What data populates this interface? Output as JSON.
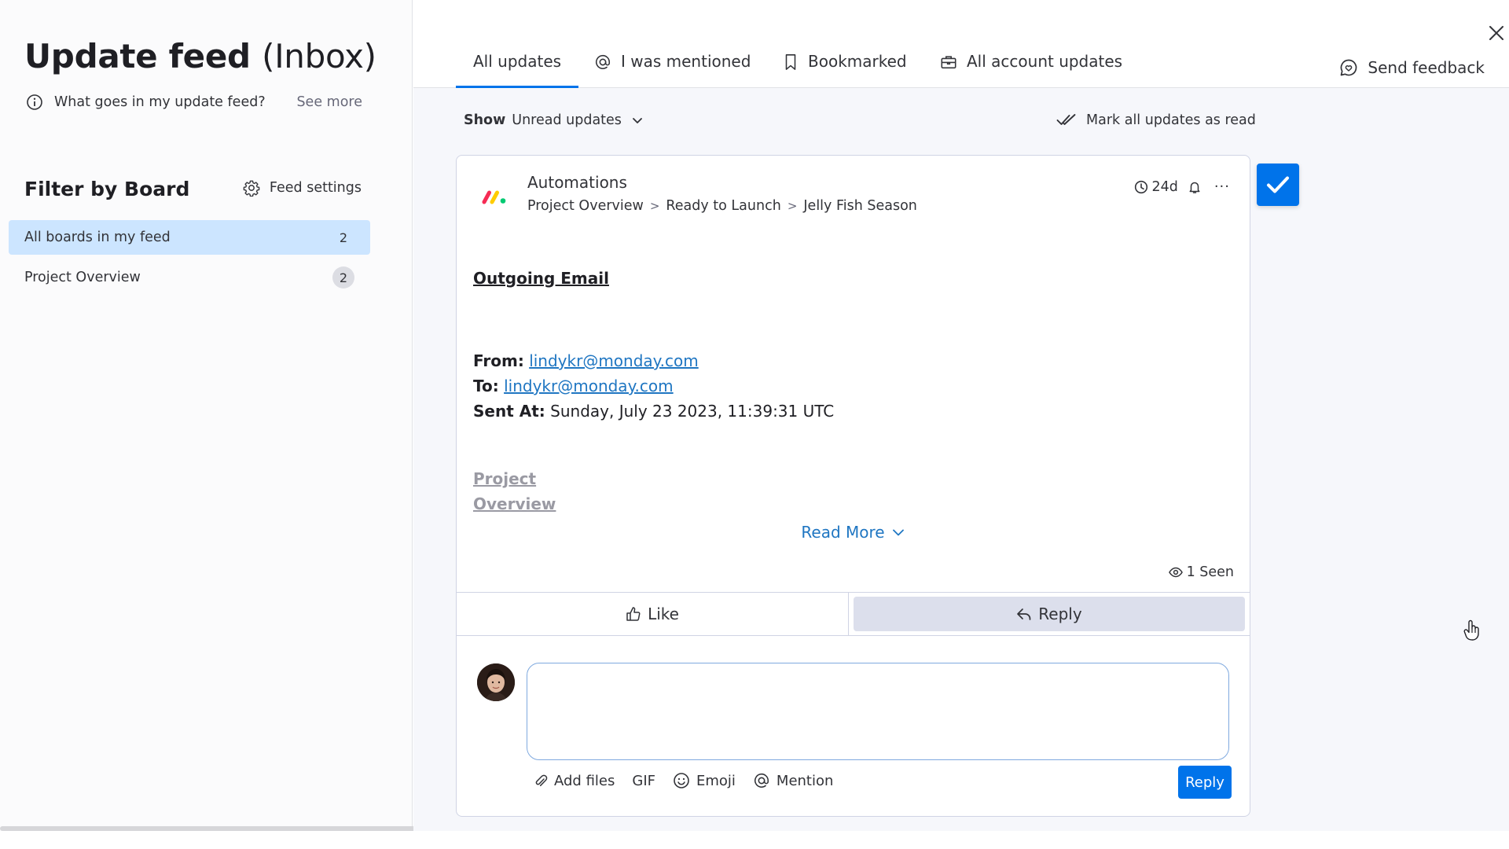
{
  "left_panel": {
    "title_main": "Update feed",
    "title_paren": "(Inbox)",
    "info_text": "What goes in my update feed?",
    "see_more": "See more",
    "filter_title": "Filter by Board",
    "feed_settings": "Feed settings",
    "boards": [
      {
        "label": "All boards in my feed",
        "count": "2",
        "active": true
      },
      {
        "label": "Project Overview",
        "count": "2",
        "active": false
      }
    ]
  },
  "tabs": [
    {
      "label": "All updates",
      "active": true
    },
    {
      "label": "I was mentioned",
      "icon": "at-icon"
    },
    {
      "label": "Bookmarked",
      "icon": "bookmark-icon"
    },
    {
      "label": "All account updates",
      "icon": "briefcase-icon"
    }
  ],
  "send_feedback": "Send feedback",
  "show": {
    "label": "Show",
    "value": "Unread updates"
  },
  "mark_all_read": "Mark all updates as read",
  "update": {
    "author": "Automations",
    "breadcrumb": [
      "Project Overview",
      "Ready to Launch",
      "Jelly Fish Season"
    ],
    "age": "24d",
    "heading": "Outgoing Email",
    "from_label": "From:",
    "from_value": "lindykr@monday.com",
    "to_label": "To:",
    "to_value": "lindykr@monday.com",
    "sent_label": "Sent At:",
    "sent_value": "Sunday, July 23 2023, 11:39:31 UTC",
    "faded_link": "Project Overview",
    "read_more": "Read More",
    "seen": "1 Seen",
    "like": "Like",
    "reply": "Reply"
  },
  "editor": {
    "add_files": "Add files",
    "gif": "GIF",
    "emoji": "Emoji",
    "mention": "Mention",
    "submit": "Reply"
  },
  "colors": {
    "accent": "#0073ea",
    "active_board": "#cce5ff",
    "link": "#1f76c2"
  }
}
